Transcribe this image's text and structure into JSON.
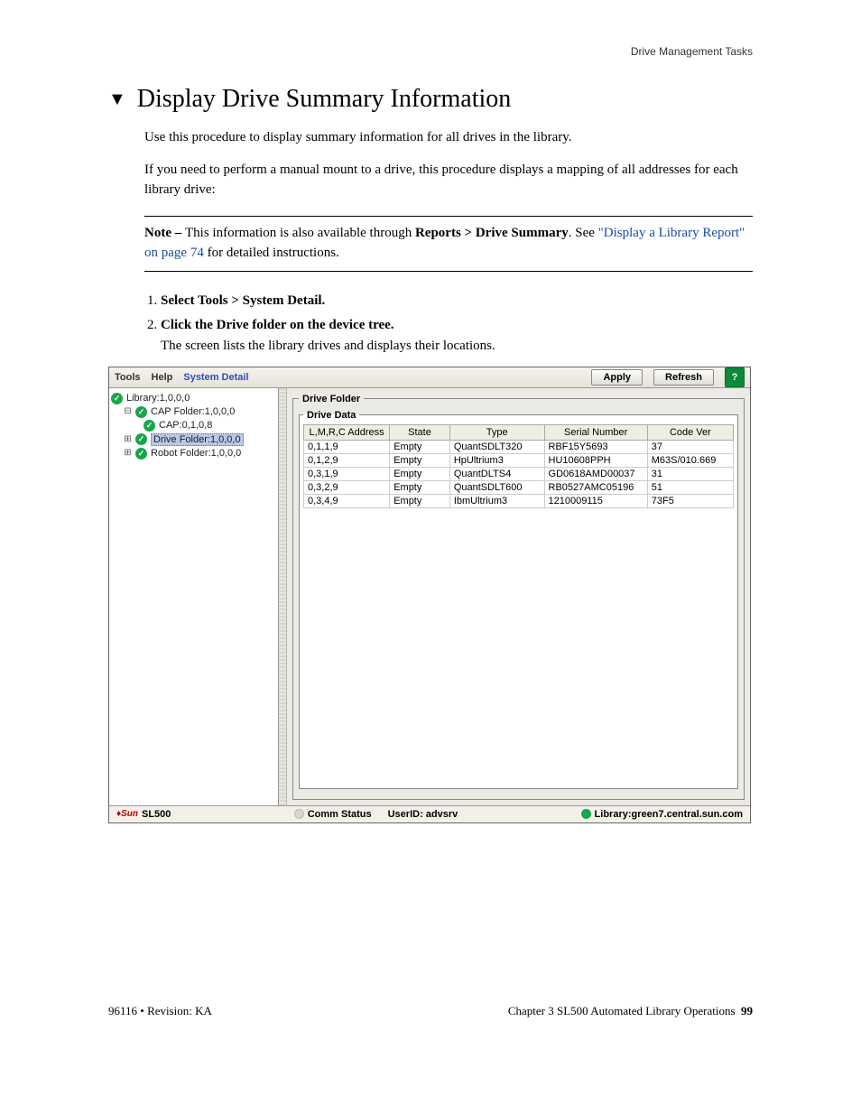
{
  "running_head": "Drive Management Tasks",
  "title": "Display Drive Summary Information",
  "para1": "Use this procedure to display summary information for all drives in the library.",
  "para2": "If you need to perform a manual mount to a drive, this procedure displays a mapping of all addresses for each library drive:",
  "note": {
    "label": "Note – ",
    "text_a": "This information is also available through ",
    "bold": "Reports > Drive Summary",
    "text_b": ". See ",
    "link": "\"Display a Library Report\" on page 74",
    "text_c": " for detailed instructions."
  },
  "steps": [
    {
      "head": "Select Tools > System Detail."
    },
    {
      "head": "Click the Drive folder on the device tree.",
      "body": "The screen lists the library drives and displays their locations."
    }
  ],
  "app": {
    "menus": {
      "tools": "Tools",
      "help": "Help",
      "detail": "System Detail"
    },
    "buttons": {
      "apply": "Apply",
      "refresh": "Refresh"
    },
    "tree": {
      "root": "Library:1,0,0,0",
      "cap_folder": "CAP Folder:1,0,0,0",
      "cap_item": "CAP:0,1,0,8",
      "drive_folder": "Drive Folder:1,0,0,0",
      "robot_folder": "Robot Folder:1,0,0,0"
    },
    "fieldset": {
      "outer": "Drive Folder",
      "inner": "Drive Data"
    },
    "columns": [
      "L,M,R,C Address",
      "State",
      "Type",
      "Serial Number",
      "Code Ver"
    ],
    "rows": [
      [
        "0,1,1,9",
        "Empty",
        "QuantSDLT320",
        "RBF15Y5693",
        "37"
      ],
      [
        "0,1,2,9",
        "Empty",
        "HpUltrium3",
        "HU10608PPH",
        "M63S/010.669"
      ],
      [
        "0,3,1,9",
        "Empty",
        "QuantDLTS4",
        "GD0618AMD00037",
        "31"
      ],
      [
        "0,3,2,9",
        "Empty",
        "QuantSDLT600",
        "RB0527AMC05196",
        "51"
      ],
      [
        "0,3,4,9",
        "Empty",
        "IbmUltrium3",
        "1210009115",
        "73F5"
      ]
    ],
    "status": {
      "brand": "Sun",
      "product": "SL500",
      "comm": "Comm Status",
      "user": "UserID: advsrv",
      "lib": "Library:green7.central.sun.com"
    }
  },
  "footer": {
    "left": "96116 • Revision: KA",
    "right_a": "Chapter 3 SL500 Automated Library Operations",
    "right_b": "99"
  }
}
